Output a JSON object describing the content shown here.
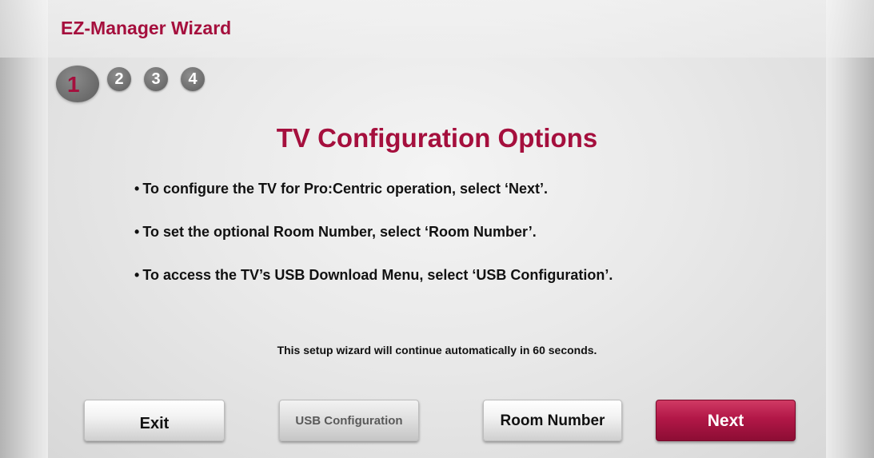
{
  "header": {
    "title": "EZ-Manager Wizard"
  },
  "steps": {
    "current": 1,
    "items": [
      {
        "label": "1",
        "active": true
      },
      {
        "label": "2",
        "active": false
      },
      {
        "label": "3",
        "active": false
      },
      {
        "label": "4",
        "active": false
      }
    ]
  },
  "main": {
    "heading": "TV Configuration Options",
    "bullet_symbol": "•",
    "bullets": [
      "To configure the TV for Pro:Centric operation, select ‘Next’.",
      "To set the optional Room Number, select ‘Room Number’.",
      "To access the TV’s USB Download Menu, select ‘USB Configuration’."
    ],
    "countdown": "This setup wizard will continue automatically in 60 seconds."
  },
  "buttons": {
    "exit": "Exit",
    "usb_configuration": "USB Configuration",
    "room_number": "Room Number",
    "next": "Next"
  },
  "colors": {
    "accent": "#a50f3d",
    "text": "#111111",
    "step_gray": "#6c6c6c"
  }
}
